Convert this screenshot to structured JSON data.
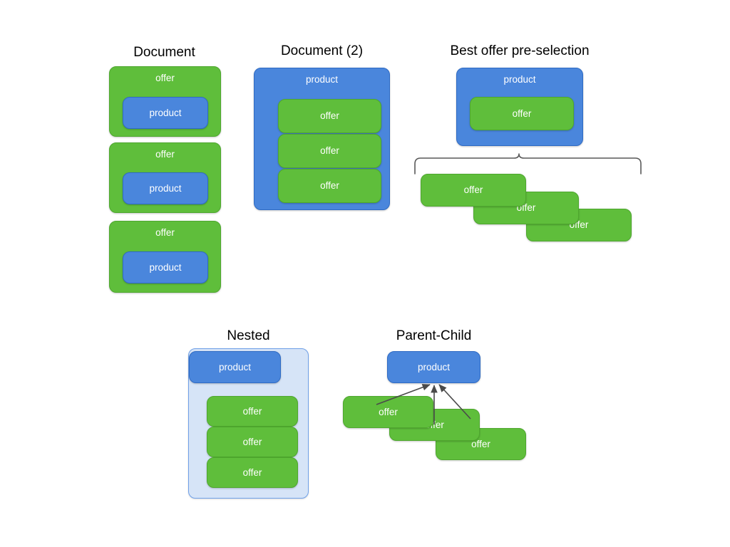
{
  "diagram": {
    "title_font_px": 19,
    "colors": {
      "green_fill": "#5FBE3B",
      "green_border": "#4EA72E",
      "blue_fill": "#4A86DC",
      "blue_border": "#2F6BC4",
      "lightblue_fill": "#D6E4F7",
      "lightblue_border": "#6FA0E8",
      "arrow": "#4A4A4A",
      "brace": "#595959",
      "background": "#FFFFFF",
      "title_text": "#000000",
      "box_text": "#FFFFFF"
    },
    "labels": {
      "offer": "offer",
      "product": "product"
    },
    "panels": [
      {
        "id": "document",
        "title": "Document",
        "description": "Three separate green offer documents, each embedding one blue product box.",
        "groups": [
          {
            "outer": "offer",
            "inner": "product"
          },
          {
            "outer": "offer",
            "inner": "product"
          },
          {
            "outer": "offer",
            "inner": "product"
          }
        ]
      },
      {
        "id": "document-2",
        "title": "Document (2)",
        "description": "One blue product document embedding three green offer boxes.",
        "outer": "product",
        "inner": [
          "offer",
          "offer",
          "offer"
        ]
      },
      {
        "id": "best-offer-pre-selection",
        "title": "Best offer pre-selection",
        "description": "A blue product document embedding the single best green offer, with a brace pointing to the full stack of candidate offers below.",
        "outer": "product",
        "inner": [
          "offer"
        ],
        "stack": [
          "offer",
          "offer",
          "offer"
        ],
        "brace": true
      },
      {
        "id": "nested",
        "title": "Nested",
        "description": "A light blue container holding one blue product box and three green offer boxes.",
        "container": "",
        "product": "product",
        "offers": [
          "offer",
          "offer",
          "offer"
        ]
      },
      {
        "id": "parent-child",
        "title": "Parent-Child",
        "description": "A blue product box with three arrows coming from a cascading stack of three green offer boxes.",
        "parent": "product",
        "children": [
          "offer",
          "offer",
          "offer"
        ],
        "arrow_count": 3
      }
    ]
  }
}
